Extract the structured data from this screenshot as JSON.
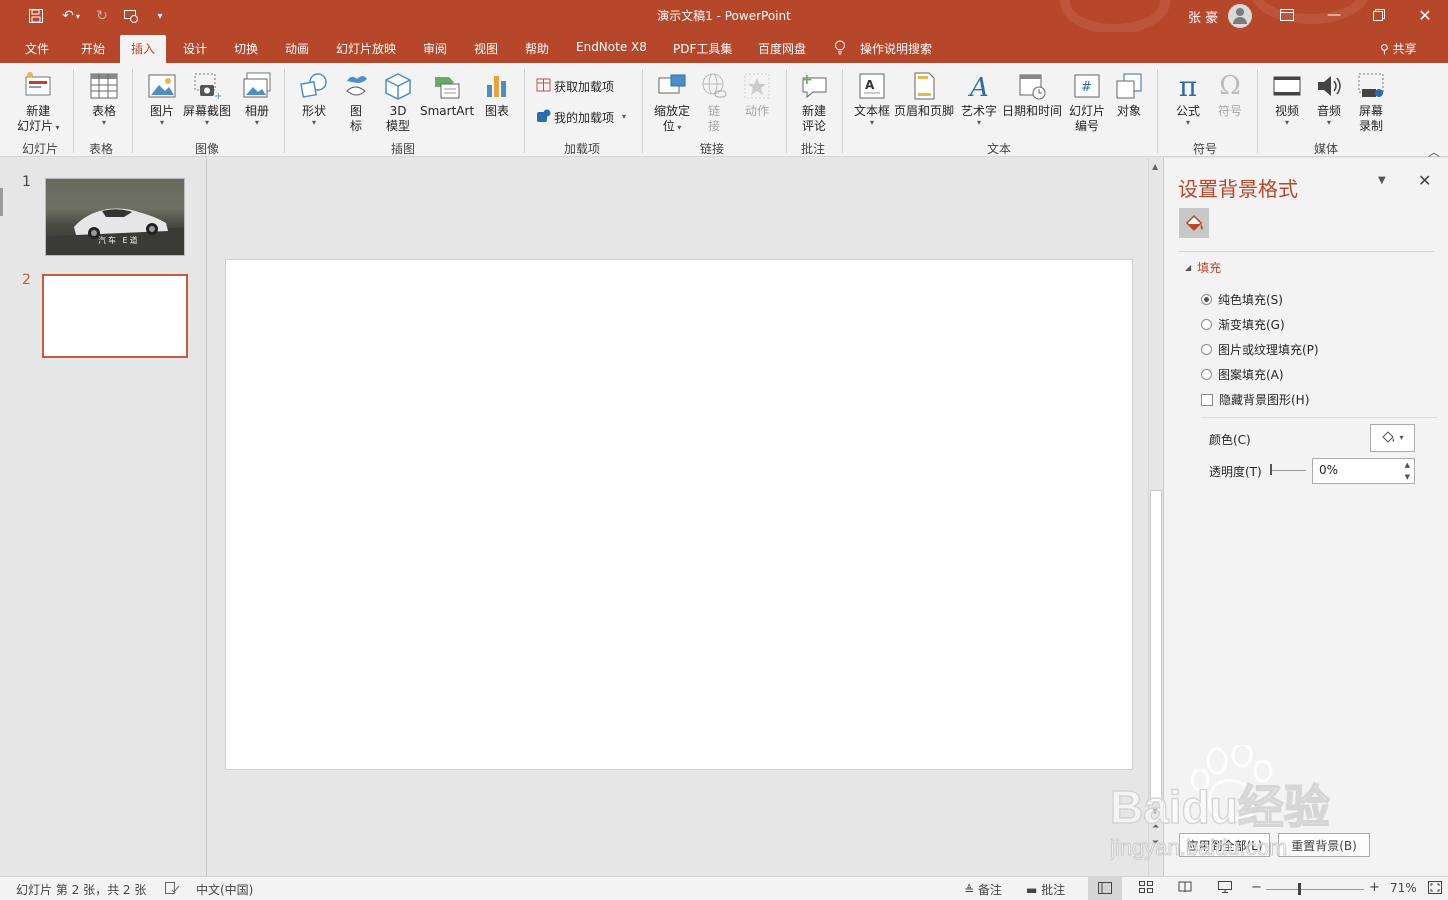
{
  "window": {
    "title": "演示文稿1 - PowerPoint",
    "user": "张 豪",
    "accent_color": "#b7472a",
    "quick_access": [
      "save-icon",
      "undo-icon",
      "redo-icon",
      "present-icon",
      "customize-icon"
    ]
  },
  "tabs": [
    "文件",
    "开始",
    "插入",
    "设计",
    "切换",
    "动画",
    "幻灯片放映",
    "审阅",
    "视图",
    "帮助",
    "EndNote X8",
    "PDF工具集",
    "百度网盘"
  ],
  "active_tab": "插入",
  "tell_me": "操作说明搜索",
  "share": "共享",
  "ribbon": {
    "new_slide": [
      "新建",
      "幻灯片"
    ],
    "table": "表格",
    "picture": "图片",
    "screenshot": "屏幕截图",
    "album": "相册",
    "shapes": "形状",
    "icons": [
      "图",
      "标"
    ],
    "model3d": [
      "3D",
      "模型"
    ],
    "smartart": "SmartArt",
    "chart": "图表",
    "get_addins": "获取加载项",
    "my_addins": "我的加载项",
    "zoom": [
      "缩放定",
      "位"
    ],
    "link": [
      "链",
      "接"
    ],
    "action": "动作",
    "new_comment": [
      "新建",
      "评论"
    ],
    "textbox": "文本框",
    "header_footer": "页眉和页脚",
    "wordart": "艺术字",
    "datetime": "日期和时间",
    "slide_number": [
      "幻灯片",
      "编号"
    ],
    "object": "对象",
    "equation": "公式",
    "symbol": "符号",
    "video": "视频",
    "audio": "音频",
    "screen_record": [
      "屏幕",
      "录制"
    ],
    "groups": {
      "slides": "幻灯片",
      "tables": "表格",
      "images": "图像",
      "illustrations": "插图",
      "addins": "加载项",
      "links": "链接",
      "comments": "批注",
      "text": "文本",
      "symbols": "符号",
      "media": "媒体"
    }
  },
  "thumbnails": [
    {
      "number": "1",
      "caption": "汽车 E道"
    },
    {
      "number": "2"
    }
  ],
  "format_pane": {
    "title": "设置背景格式",
    "section": "填充",
    "options": [
      "纯色填充(S)",
      "渐变填充(G)",
      "图片或纹理填充(P)",
      "图案填充(A)"
    ],
    "selected_option": 0,
    "hide_background": "隐藏背景图形(H)",
    "color_label": "颜色(C)",
    "transparency_label": "透明度(T)",
    "transparency_value": "0%",
    "apply_all": "应用到全部(L)",
    "reset": "重置背景(B)"
  },
  "status": {
    "slide_info": "幻灯片 第 2 张，共 2 张",
    "language": "中文(中国)",
    "notes": "备注",
    "comments": "批注",
    "zoom": "71%",
    "zoom_level": 0.71
  },
  "watermark": {
    "logo": "Baidu经验",
    "url": "jingyan.baidu.com"
  }
}
